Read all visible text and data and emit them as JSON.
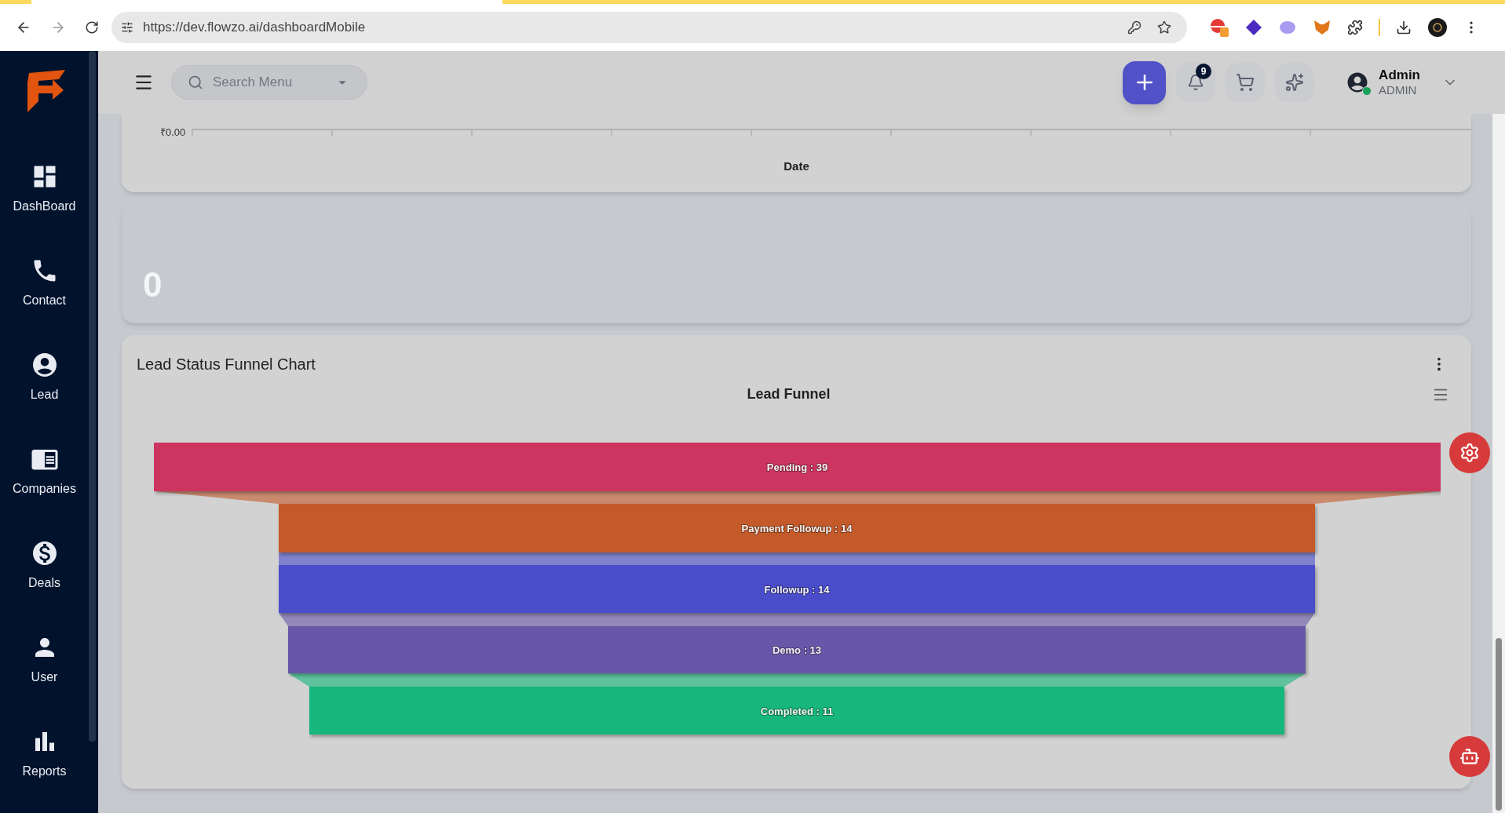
{
  "browser": {
    "url": "https://dev.flowzo.ai/dashboardMobile"
  },
  "sidebar": {
    "items": [
      {
        "label": "DashBoard"
      },
      {
        "label": "Contact"
      },
      {
        "label": "Lead"
      },
      {
        "label": "Companies"
      },
      {
        "label": "Deals"
      },
      {
        "label": "User"
      },
      {
        "label": "Reports"
      }
    ]
  },
  "header": {
    "search": {
      "placeholder": "Search Menu"
    },
    "notification_count": "9",
    "user": {
      "name": "Admin",
      "role": "ADMIN",
      "online": true
    }
  },
  "revenue_card": {
    "axis_tick": "₹0.00",
    "axis_title": "Date"
  },
  "stat_card": {
    "value": "0"
  },
  "funnel_card": {
    "title": "Lead Status Funnel Chart",
    "chart_title": "Lead Funnel",
    "stages": [
      {
        "label": "Pending : 39",
        "color": "#cc3461"
      },
      {
        "label": "Payment Followup : 14",
        "color": "#c45a2b"
      },
      {
        "label": "Followup : 14",
        "color": "#484dc9"
      },
      {
        "label": "Demo : 13",
        "color": "#6857a8"
      },
      {
        "label": "Completed : 11",
        "color": "#12b67c"
      }
    ]
  }
}
